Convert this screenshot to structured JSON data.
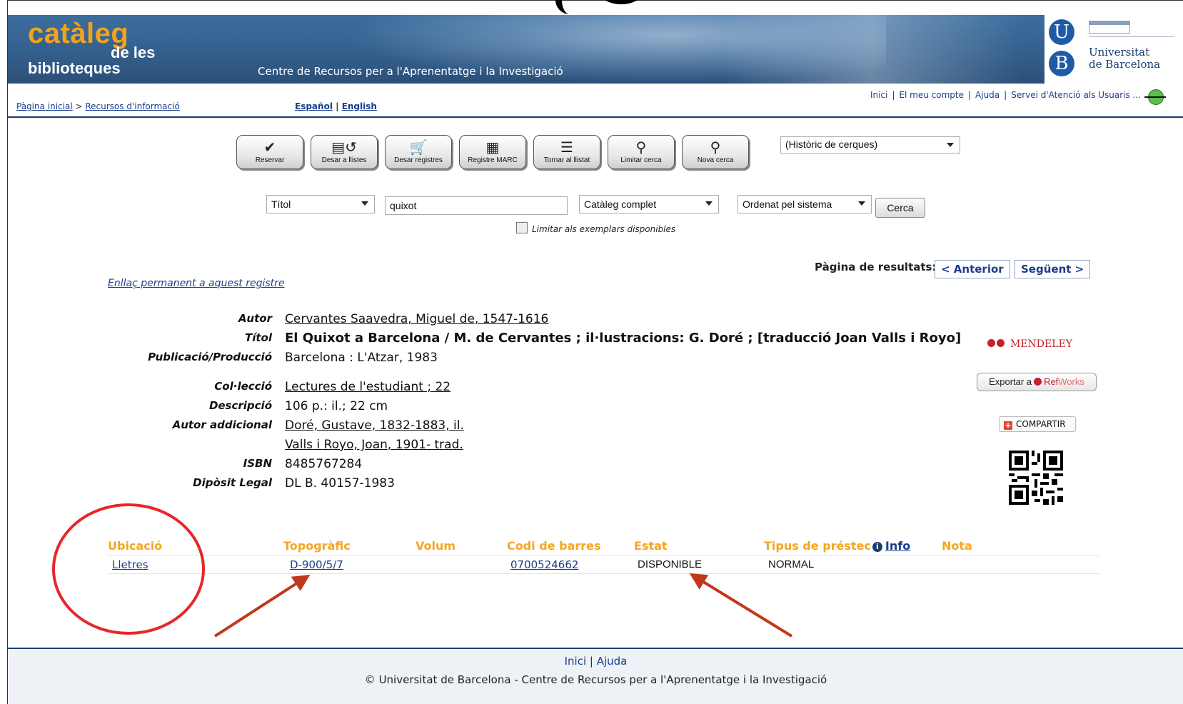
{
  "header": {
    "logo": {
      "line1": "catàleg",
      "line2": "de les",
      "line3": "biblioteques"
    },
    "subtitle": "Centre de Recursos per a l'Aprenentatge i la Investigació",
    "university": {
      "u": "U",
      "b": "B",
      "name_line1": "Universitat",
      "name_line2": "de Barcelona"
    }
  },
  "nav": {
    "breadcrumb": {
      "home": "Pàgina inicial",
      "sep": " > ",
      "current": "Recursos d'informació"
    },
    "languages": {
      "es": "Español",
      "sep": " | ",
      "en": "English"
    },
    "toplinks": [
      "Inici",
      "El meu compte",
      "Ajuda",
      "Servei d'Atenció als Usuaris ..."
    ]
  },
  "toolbar": {
    "buttons": [
      "Reservar",
      "Desar a llistes",
      "Desar registres",
      "Registre MARC",
      "Tornar al llistat",
      "Limitar cerca",
      "Nova cerca"
    ],
    "history_select": "(Històric de cerques)"
  },
  "search": {
    "field_select": "Títol",
    "query": "quixot",
    "scope_select": "Catàleg complet",
    "sort_select": "Ordenat pel sistema",
    "submit": "Cerca",
    "limit_available": "Limitar als exemplars disponibles"
  },
  "pager": {
    "label": "Pàgina de resultats:",
    "prev": "< Anterior",
    "next": "Següent >"
  },
  "permalink": "Enllaç permanent a aquest registre",
  "record": {
    "autor_label": "Autor",
    "autor": "Cervantes Saavedra, Miguel de, 1547-1616",
    "titol_label": "Títol",
    "titol": "El Quixot a Barcelona / M. de Cervantes ; il·lustracions: G. Doré ; [traducció Joan Valls i Royo]",
    "pub_label": "Publicació/Producció",
    "pub": "Barcelona : L'Atzar, 1983",
    "coleccio_label": "Col·lecció",
    "coleccio": "Lectures de l'estudiant ; 22",
    "descripcio_label": "Descripció",
    "descripcio": "106 p.: il.; 22 cm",
    "autor_add_label": "Autor addicional",
    "autor_add_1": "Doré, Gustave, 1832-1883, il.",
    "autor_add_2": "Valls i Royo, Joan, 1901- trad.",
    "isbn_label": "ISBN",
    "isbn": "8485767284",
    "dl_label": "Dipòsit Legal",
    "dl": "DL B. 40157-1983"
  },
  "sidebar": {
    "mendeley": "MENDELEY",
    "refworks_prefix": "Exportar a",
    "refworks_ref": "Ref",
    "refworks_works": "Works",
    "share": "COMPARTIR"
  },
  "holdings": {
    "headers": [
      "Ubicació",
      "Topogràfic",
      "Volum",
      "Codi de barres",
      "Estat",
      "Tipus de préstec",
      "Info",
      "Nota"
    ],
    "rows": [
      {
        "ubicacio": "Lletres",
        "topografic": "D-900/5/7",
        "volum": "",
        "codi": "0700524662",
        "estat": "DISPONIBLE",
        "tipus": "NORMAL",
        "nota": ""
      }
    ]
  },
  "footer": {
    "inici": "Inici",
    "sep": " | ",
    "ajuda": "Ajuda",
    "copyright": "© Universitat de Barcelona - Centre de Recursos per a l'Aprenentatge i la Investigació"
  },
  "colors": {
    "orange": "#f5a623",
    "header_blue": "#345f8c",
    "link": "#1a3e8c",
    "annotation_red": "#e8262a",
    "arrow": "#c0391b"
  }
}
